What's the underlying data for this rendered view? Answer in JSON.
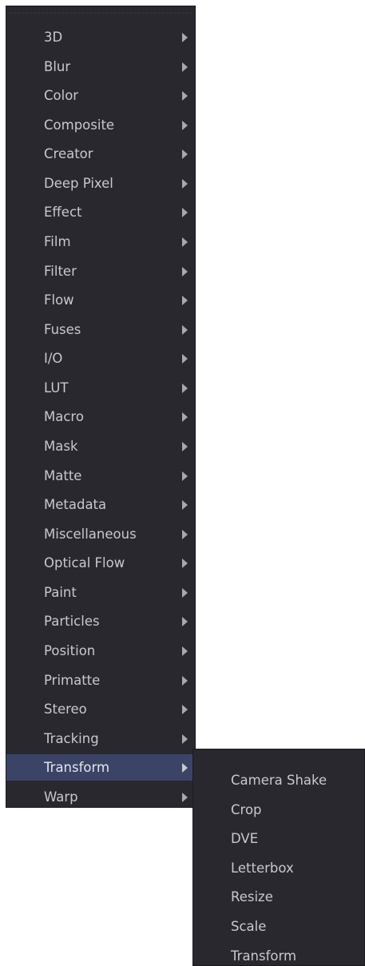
{
  "main_menu": {
    "items": [
      {
        "label": "3D"
      },
      {
        "label": "Blur"
      },
      {
        "label": "Color"
      },
      {
        "label": "Composite"
      },
      {
        "label": "Creator"
      },
      {
        "label": "Deep Pixel"
      },
      {
        "label": "Effect"
      },
      {
        "label": "Film"
      },
      {
        "label": "Filter"
      },
      {
        "label": "Flow"
      },
      {
        "label": "Fuses"
      },
      {
        "label": "I/O"
      },
      {
        "label": "LUT"
      },
      {
        "label": "Macro"
      },
      {
        "label": "Mask"
      },
      {
        "label": "Matte"
      },
      {
        "label": "Metadata"
      },
      {
        "label": "Miscellaneous"
      },
      {
        "label": "Optical Flow"
      },
      {
        "label": "Paint"
      },
      {
        "label": "Particles"
      },
      {
        "label": "Position"
      },
      {
        "label": "Primatte"
      },
      {
        "label": "Stereo"
      },
      {
        "label": "Tracking"
      },
      {
        "label": "Transform",
        "active": true
      },
      {
        "label": "Warp"
      }
    ]
  },
  "sub_menu": {
    "parent": "Transform",
    "items": [
      {
        "label": "Camera Shake"
      },
      {
        "label": "Crop"
      },
      {
        "label": "DVE"
      },
      {
        "label": "Letterbox"
      },
      {
        "label": "Resize"
      },
      {
        "label": "Scale"
      },
      {
        "label": "Transform"
      }
    ]
  },
  "colors": {
    "menu_bg": "#28282e",
    "menu_text": "#c9c9cc",
    "highlight_bg": "#3b4467",
    "arrow": "#a8a8ad"
  },
  "icons": {
    "submenu_indicator": "chevron-right-icon"
  }
}
